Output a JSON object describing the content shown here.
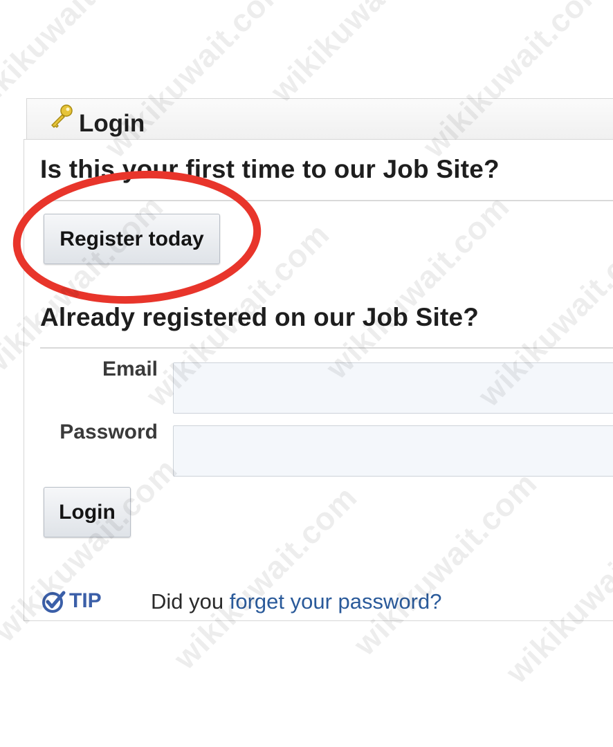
{
  "header": {
    "title": "Login",
    "icon": "key-icon"
  },
  "register_section": {
    "heading": "Is this your first time to our Job Site?",
    "button_label": "Register today"
  },
  "login_section": {
    "heading": "Already registered on our Job Site?",
    "email_label": "Email",
    "email_value": "",
    "password_label": "Password",
    "password_value": "",
    "login_button_label": "Login"
  },
  "tip": {
    "icon": "checkmark-badge-icon",
    "label": "TIP",
    "text_prefix": "Did you ",
    "link_text": "forget your password?"
  },
  "annotation": {
    "color": "#e8352b"
  },
  "watermark": {
    "text": "wikikuwait.com"
  },
  "colors": {
    "link": "#2a5a9a",
    "tip": "#3b5fa8",
    "highlight": "#e8352b"
  }
}
